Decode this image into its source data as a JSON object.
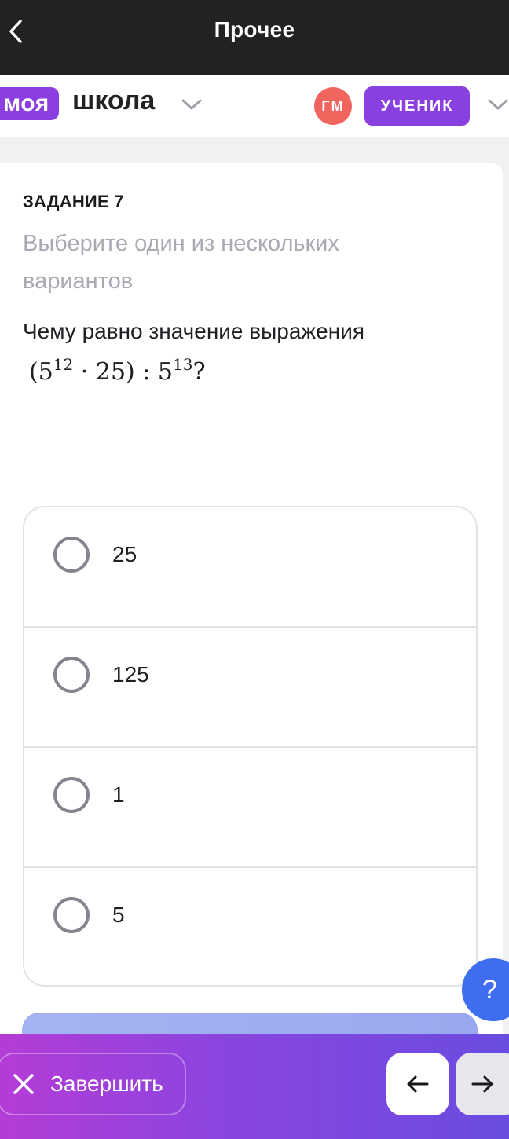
{
  "topbar": {
    "title": "Прочее",
    "back_icon": "chevron-left-icon"
  },
  "header": {
    "logo_part1": "моя",
    "logo_part2": "школа",
    "avatar_initials": "ГМ",
    "role": "УЧЕНИК",
    "colors": {
      "brand_purple": "#8b3fe0",
      "avatar_red": "#f0665e"
    }
  },
  "task": {
    "label": "ЗАДАНИЕ 7",
    "hint": "Выберите один из нескольких вариантов",
    "question": "Чему равно значение выражения",
    "formula": {
      "open": "(5",
      "exp1": "12",
      "mid": " · 25) : 5",
      "exp2": "13",
      "end": "?"
    }
  },
  "options": [
    {
      "label": "25",
      "selected": false
    },
    {
      "label": "125",
      "selected": false
    },
    {
      "label": "1",
      "selected": false
    },
    {
      "label": "5",
      "selected": false
    }
  ],
  "help": {
    "label": "?"
  },
  "bottombar": {
    "finish_label": "Завершить",
    "finish_icon": "close-icon",
    "prev_icon": "arrow-left-icon",
    "next_icon": "arrow-right-icon"
  }
}
